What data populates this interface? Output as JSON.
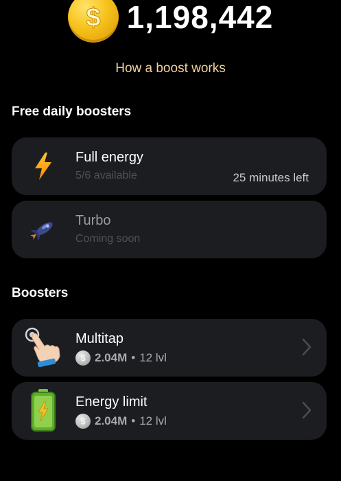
{
  "balance": {
    "value": "1,198,442",
    "coin_icon": "dollar-coin-icon"
  },
  "how_link": "How a boost works",
  "free_section": {
    "title": "Free daily boosters",
    "items": [
      {
        "title": "Full energy",
        "subtitle": "5/6 available",
        "right": "25 minutes left",
        "icon": "lightning-icon"
      },
      {
        "title": "Turbo",
        "subtitle": "Coming soon",
        "icon": "rocket-icon"
      }
    ]
  },
  "boosters_section": {
    "title": "Boosters",
    "items": [
      {
        "title": "Multitap",
        "cost": "2.04M",
        "dot": "•",
        "level": "12 lvl",
        "icon": "tap-hand-icon"
      },
      {
        "title": "Energy limit",
        "cost": "2.04M",
        "dot": "•",
        "level": "12 lvl",
        "icon": "battery-icon"
      }
    ]
  },
  "colors": {
    "background": "#000000",
    "card": "#1c1d21",
    "link": "#f2d29b",
    "coin": "#f6c21a"
  }
}
